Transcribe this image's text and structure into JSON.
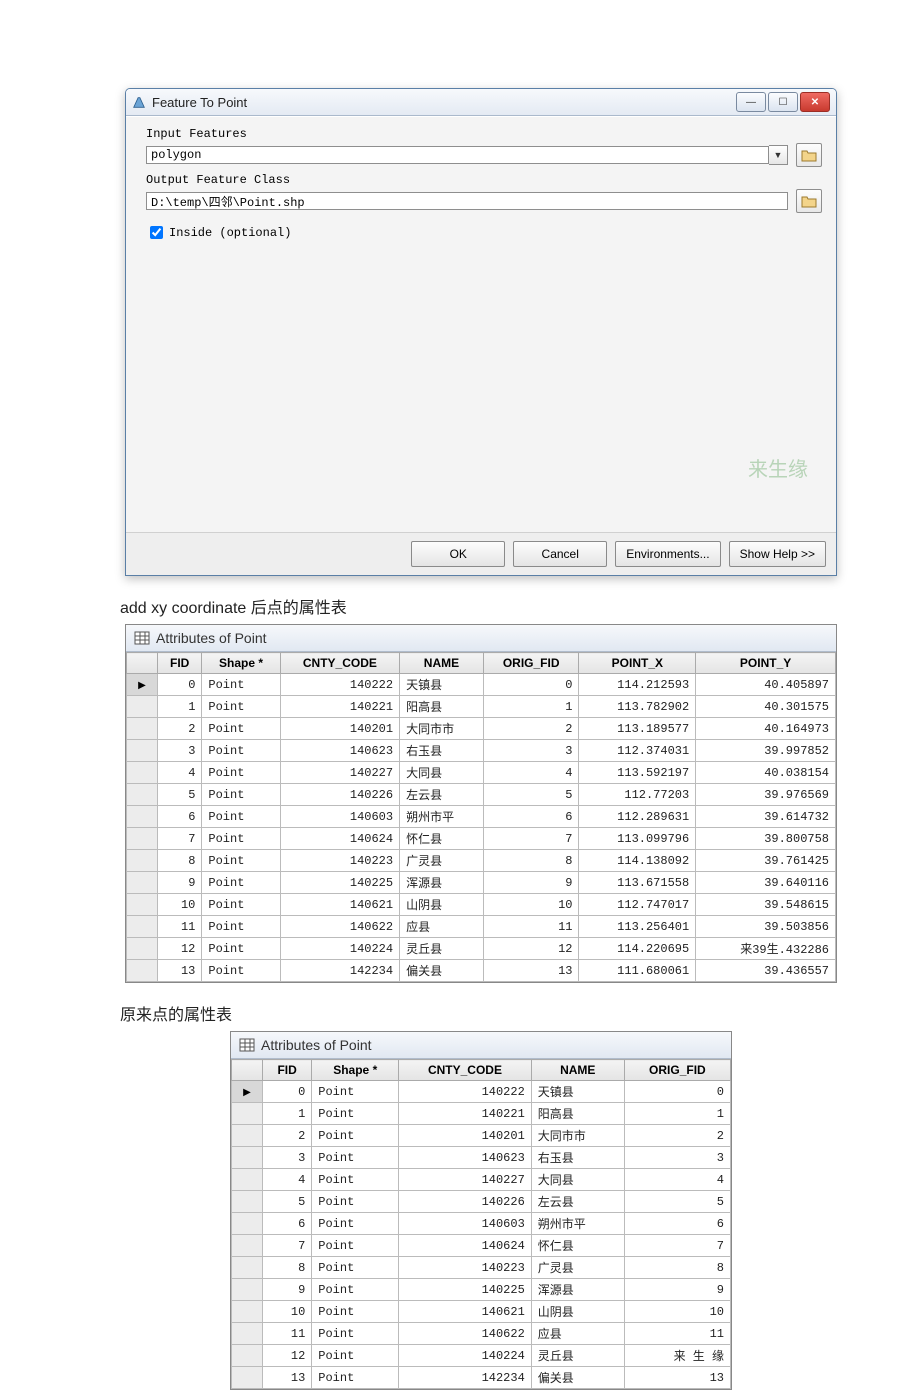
{
  "dialog": {
    "title": "Feature To Point",
    "input_features_label": "Input Features",
    "input_features_value": "polygon",
    "output_label": "Output Feature Class",
    "output_value": "D:\\temp\\四邻\\Point.shp",
    "inside_label": "Inside (optional)",
    "watermark": "来生缘",
    "buttons": {
      "ok": "OK",
      "cancel": "Cancel",
      "env": "Environments...",
      "help": "Show Help >>"
    }
  },
  "caption1": "add xy coordinate 后点的属性表",
  "caption2": "原来点的属性表",
  "attr_title": "Attributes of Point",
  "cols_full": [
    "FID",
    "Shape *",
    "CNTY_CODE",
    "NAME",
    "ORIG_FID",
    "POINT_X",
    "POINT_Y"
  ],
  "cols_small": [
    "FID",
    "Shape *",
    "CNTY_CODE",
    "NAME",
    "ORIG_FID"
  ],
  "rows_full": [
    {
      "fid": "0",
      "shape": "Point",
      "code": "140222",
      "name": "天镇县",
      "orig": "0",
      "x": "114.212593",
      "y": "40.405897"
    },
    {
      "fid": "1",
      "shape": "Point",
      "code": "140221",
      "name": "阳高县",
      "orig": "1",
      "x": "113.782902",
      "y": "40.301575"
    },
    {
      "fid": "2",
      "shape": "Point",
      "code": "140201",
      "name": "大同市市",
      "orig": "2",
      "x": "113.189577",
      "y": "40.164973"
    },
    {
      "fid": "3",
      "shape": "Point",
      "code": "140623",
      "name": "右玉县",
      "orig": "3",
      "x": "112.374031",
      "y": "39.997852"
    },
    {
      "fid": "4",
      "shape": "Point",
      "code": "140227",
      "name": "大同县",
      "orig": "4",
      "x": "113.592197",
      "y": "40.038154"
    },
    {
      "fid": "5",
      "shape": "Point",
      "code": "140226",
      "name": "左云县",
      "orig": "5",
      "x": "112.77203",
      "y": "39.976569"
    },
    {
      "fid": "6",
      "shape": "Point",
      "code": "140603",
      "name": "朔州市平",
      "orig": "6",
      "x": "112.289631",
      "y": "39.614732"
    },
    {
      "fid": "7",
      "shape": "Point",
      "code": "140624",
      "name": "怀仁县",
      "orig": "7",
      "x": "113.099796",
      "y": "39.800758"
    },
    {
      "fid": "8",
      "shape": "Point",
      "code": "140223",
      "name": "广灵县",
      "orig": "8",
      "x": "114.138092",
      "y": "39.761425"
    },
    {
      "fid": "9",
      "shape": "Point",
      "code": "140225",
      "name": "浑源县",
      "orig": "9",
      "x": "113.671558",
      "y": "39.640116"
    },
    {
      "fid": "10",
      "shape": "Point",
      "code": "140621",
      "name": "山阴县",
      "orig": "10",
      "x": "112.747017",
      "y": "39.548615"
    },
    {
      "fid": "11",
      "shape": "Point",
      "code": "140622",
      "name": "应县",
      "orig": "11",
      "x": "113.256401",
      "y": "39.503856"
    },
    {
      "fid": "12",
      "shape": "Point",
      "code": "140224",
      "name": "灵丘县",
      "orig": "12",
      "x": "114.220695",
      "y": "来39生.432286"
    },
    {
      "fid": "13",
      "shape": "Point",
      "code": "142234",
      "name": "偏关县",
      "orig": "13",
      "x": "111.680061",
      "y": "39.436557"
    }
  ],
  "rows_small": [
    {
      "fid": "0",
      "shape": "Point",
      "code": "140222",
      "name": "天镇县",
      "orig": "0"
    },
    {
      "fid": "1",
      "shape": "Point",
      "code": "140221",
      "name": "阳高县",
      "orig": "1"
    },
    {
      "fid": "2",
      "shape": "Point",
      "code": "140201",
      "name": "大同市市",
      "orig": "2"
    },
    {
      "fid": "3",
      "shape": "Point",
      "code": "140623",
      "name": "右玉县",
      "orig": "3"
    },
    {
      "fid": "4",
      "shape": "Point",
      "code": "140227",
      "name": "大同县",
      "orig": "4"
    },
    {
      "fid": "5",
      "shape": "Point",
      "code": "140226",
      "name": "左云县",
      "orig": "5"
    },
    {
      "fid": "6",
      "shape": "Point",
      "code": "140603",
      "name": "朔州市平",
      "orig": "6"
    },
    {
      "fid": "7",
      "shape": "Point",
      "code": "140624",
      "name": "怀仁县",
      "orig": "7"
    },
    {
      "fid": "8",
      "shape": "Point",
      "code": "140223",
      "name": "广灵县",
      "orig": "8"
    },
    {
      "fid": "9",
      "shape": "Point",
      "code": "140225",
      "name": "浑源县",
      "orig": "9"
    },
    {
      "fid": "10",
      "shape": "Point",
      "code": "140621",
      "name": "山阴县",
      "orig": "10"
    },
    {
      "fid": "11",
      "shape": "Point",
      "code": "140622",
      "name": "应县",
      "orig": "11"
    },
    {
      "fid": "12",
      "shape": "Point",
      "code": "140224",
      "name": "灵丘县",
      "orig": "来 生 缘"
    },
    {
      "fid": "13",
      "shape": "Point",
      "code": "142234",
      "name": "偏关县",
      "orig": "13"
    }
  ]
}
